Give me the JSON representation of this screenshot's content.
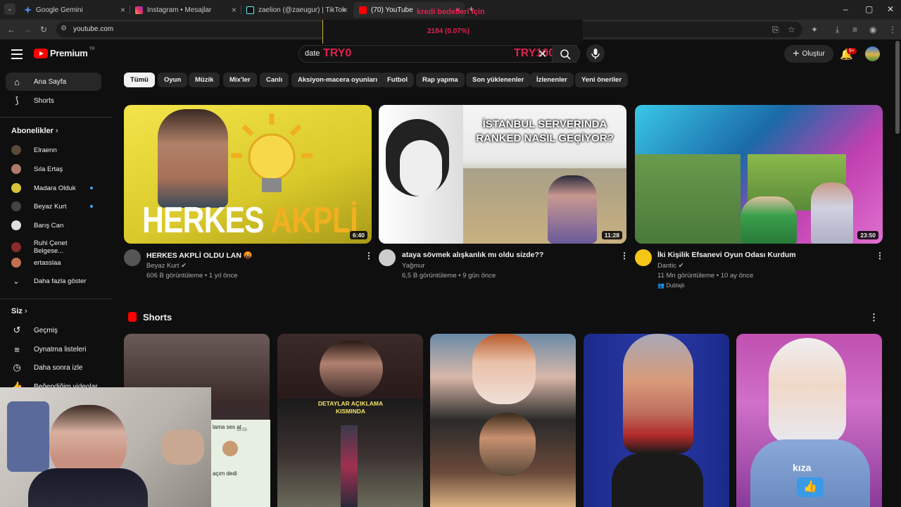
{
  "browser": {
    "tabs": [
      {
        "title": "Google Gemini",
        "favicon_color": "#4a8cf7",
        "active": false
      },
      {
        "title": "Instagram • Mesajlar",
        "favicon_color": "#e1306c",
        "active": false
      },
      {
        "title": "zaelion (@zaeugur) | TikTok",
        "favicon_color": "#ffffff",
        "active": false
      },
      {
        "title": "(70) YouTube",
        "favicon_color": "#ff0000",
        "active": true
      }
    ],
    "url": "youtube.com"
  },
  "overlay": {
    "line1": "kredi bedelleri için",
    "line2": "2184 (0.07%)"
  },
  "header": {
    "logo_text": "Premium",
    "logo_region": "TR",
    "search_value": "date",
    "overlay_left": "TRY0",
    "overlay_right": "TRY10000",
    "create_label": "Oluştur",
    "notification_count": "9+"
  },
  "sidebar": {
    "main": [
      {
        "label": "Ana Sayfa",
        "icon": "home-icon",
        "active": true
      },
      {
        "label": "Shorts",
        "icon": "shorts-icon",
        "active": false
      }
    ],
    "subscriptions_heading": "Abonelikler",
    "subscriptions": [
      {
        "label": "Elraenn",
        "color": "#5a4a3a",
        "live": false
      },
      {
        "label": "Sıla Ertaş",
        "color": "#b07a6a",
        "live": false
      },
      {
        "label": "Madara Olduk",
        "color": "#d9c23a",
        "live": true
      },
      {
        "label": "Beyaz Kurt",
        "color": "#444444",
        "live": true
      },
      {
        "label": "Barış Can",
        "color": "#e0e0e0",
        "live": false
      },
      {
        "label": "Ruhi Çenet Belgese...",
        "color": "#8a2a2a",
        "live": false
      },
      {
        "label": "ertasslaa",
        "color": "#c07050",
        "live": false
      }
    ],
    "show_more": "Daha fazla göster",
    "you_heading": "Siz",
    "you_items": [
      {
        "label": "Geçmiş",
        "icon": "history-icon"
      },
      {
        "label": "Oynatma listeleri",
        "icon": "playlist-icon"
      },
      {
        "label": "Daha sonra izle",
        "icon": "watch-later-icon"
      },
      {
        "label": "Beğendiğim videolar",
        "icon": "like-icon"
      }
    ]
  },
  "chips": [
    "Tümü",
    "Oyun",
    "Müzik",
    "Mix'ler",
    "Canlı",
    "Aksiyon-macera oyunları",
    "Futbol",
    "Rap yapma",
    "Son yüklenenler",
    "İzlenenler",
    "Yeni öneriler"
  ],
  "videos": [
    {
      "title": "HERKES AKPLİ OLDU LAN 🤬",
      "channel": "Beyaz Kurt",
      "meta": "606 B görüntüleme • 1 yıl önce",
      "duration": "6:40",
      "thumb_text_a": "HERKES",
      "thumb_text_b": "AKPLİ"
    },
    {
      "title": "ataya sövmek alışkanlık mı oldu sizde??",
      "channel": "Yağmur",
      "meta": "6,5 B görüntüleme • 9 gün önce",
      "duration": "11:28",
      "thumb_text_a": "İSTANBUL SERVERINDA",
      "thumb_text_b": "RANKED NASIL GEÇİYOR?"
    },
    {
      "title": "İki Kişilik Efsanevi Oyun Odası Kurdum",
      "channel": "Dantic",
      "meta": "11 Mn görüntüleme • 10 ay önce",
      "duration": "23:50",
      "badge": "Dublajlı"
    }
  ],
  "shorts": {
    "heading": "Shorts",
    "items": [
      {
        "caption": "",
        "bg": "#4a3a38"
      },
      {
        "caption": "DETAYLAR AÇIKLAMA KISMINDA",
        "bg": "#3a2a2a"
      },
      {
        "caption": "",
        "bg": "#5a4a48"
      },
      {
        "caption": "",
        "bg": "#1a2a6a"
      },
      {
        "caption": "kıza",
        "bg": "#b04a9a"
      }
    ]
  },
  "webcam": {
    "chat_line1": "lama ses at",
    "chat_line2": "açım dedi",
    "chat_time": "18:55"
  }
}
